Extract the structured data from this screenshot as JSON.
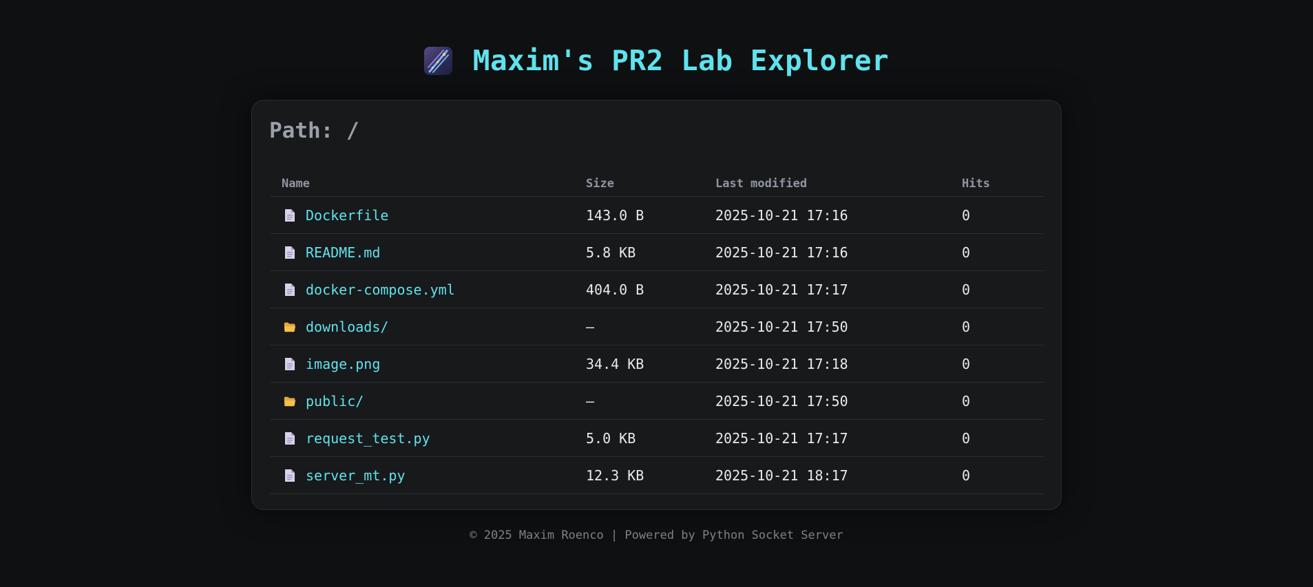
{
  "header": {
    "title": "Maxim's PR2 Lab Explorer",
    "logo_icon": "shooting-star-icon"
  },
  "path": {
    "label": "Path: /"
  },
  "table": {
    "columns": [
      "Name",
      "Size",
      "Last modified",
      "Hits"
    ],
    "rows": [
      {
        "type": "file",
        "icon": "file-icon",
        "name": "Dockerfile",
        "size": "143.0 B",
        "modified": "2025-10-21 17:16",
        "hits": "0"
      },
      {
        "type": "file",
        "icon": "file-icon",
        "name": "README.md",
        "size": "5.8 KB",
        "modified": "2025-10-21 17:16",
        "hits": "0"
      },
      {
        "type": "file",
        "icon": "file-icon",
        "name": "docker-compose.yml",
        "size": "404.0 B",
        "modified": "2025-10-21 17:17",
        "hits": "0"
      },
      {
        "type": "folder",
        "icon": "folder-icon",
        "name": "downloads/",
        "size": "—",
        "modified": "2025-10-21 17:50",
        "hits": "0"
      },
      {
        "type": "file",
        "icon": "file-icon",
        "name": "image.png",
        "size": "34.4 KB",
        "modified": "2025-10-21 17:18",
        "hits": "0"
      },
      {
        "type": "folder",
        "icon": "folder-icon",
        "name": "public/",
        "size": "—",
        "modified": "2025-10-21 17:50",
        "hits": "0"
      },
      {
        "type": "file",
        "icon": "file-icon",
        "name": "request_test.py",
        "size": "5.0 KB",
        "modified": "2025-10-21 17:17",
        "hits": "0"
      },
      {
        "type": "file",
        "icon": "file-icon",
        "name": "server_mt.py",
        "size": "12.3 KB",
        "modified": "2025-10-21 18:17",
        "hits": "0"
      }
    ]
  },
  "footer": {
    "text": "© 2025 Maxim Roenco | Powered by Python Socket Server"
  },
  "colors": {
    "background": "#0f1011",
    "card": "#18191b",
    "accent": "#5fe3ee",
    "folder": "#f5c04a",
    "file": "#d8d2ea"
  }
}
